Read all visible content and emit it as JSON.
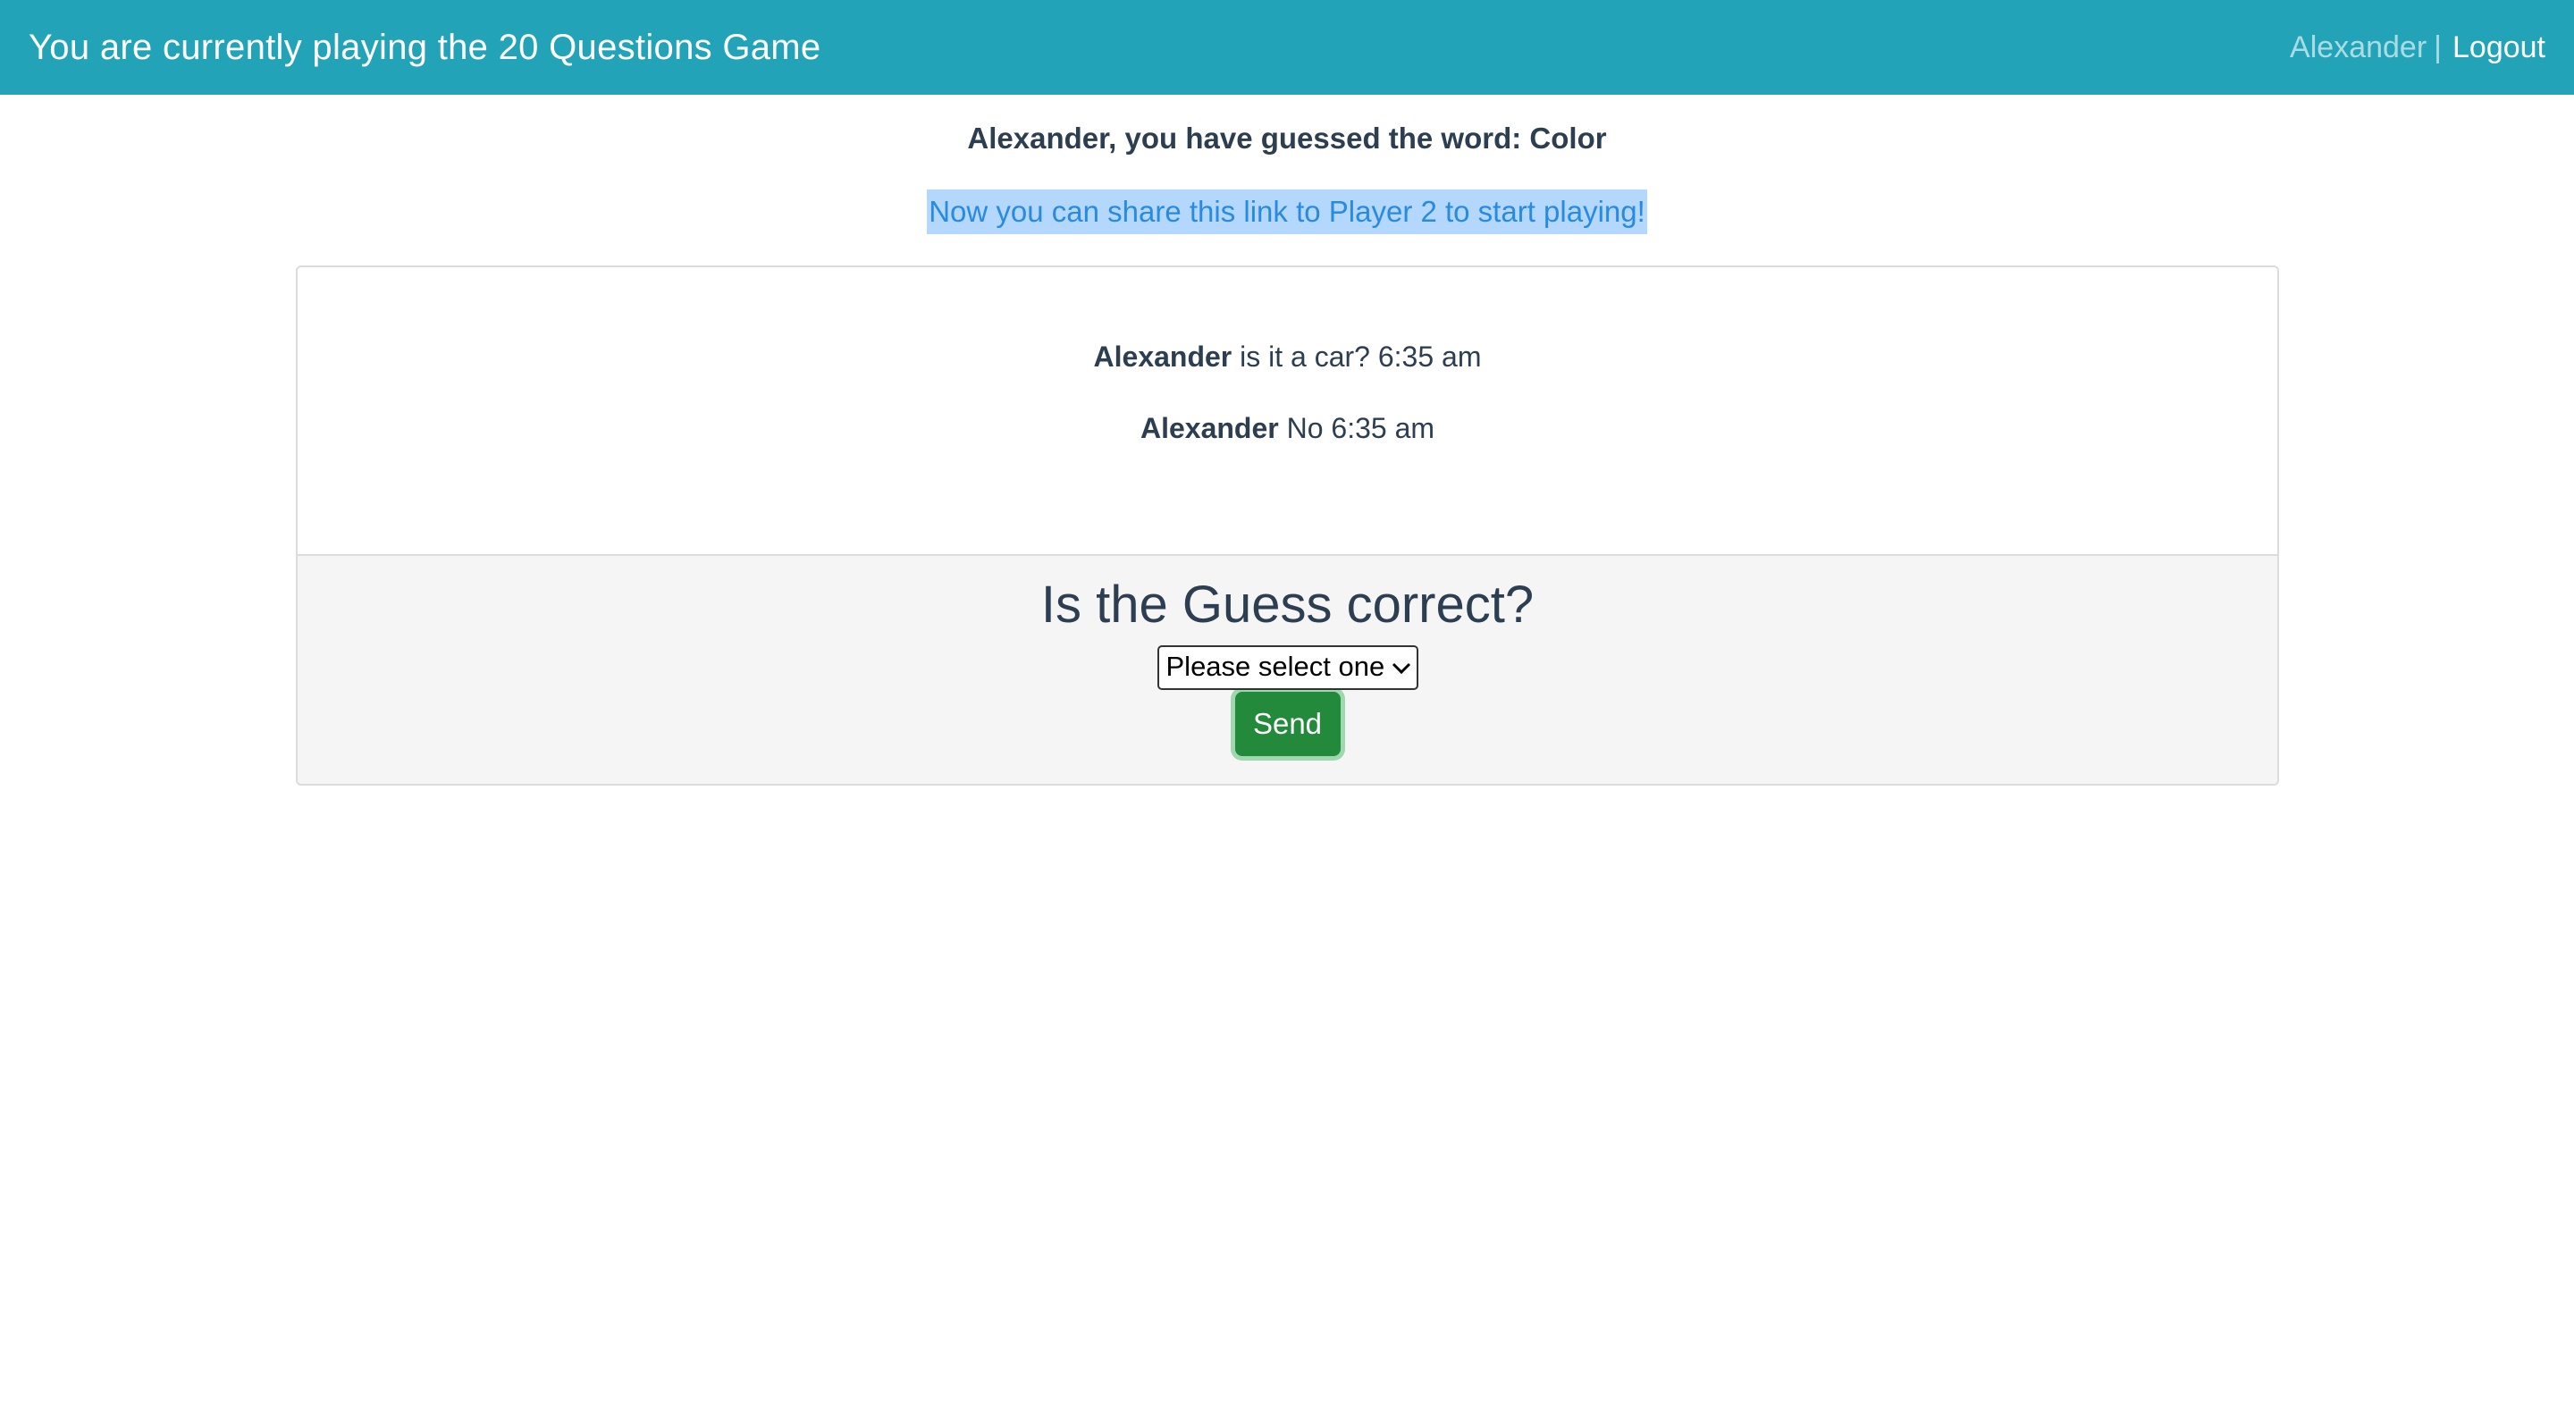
{
  "navbar": {
    "title": "You are currently playing the 20 Questions Game",
    "user": "Alexander",
    "separator": "|",
    "logout": "Logout"
  },
  "status": {
    "headline": "Alexander, you have guessed the word: Color",
    "share_link": "Now you can share this link to Player 2 to start playing!"
  },
  "messages": [
    {
      "author": "Alexander",
      "text": "is it a car?",
      "time": "6:35 am"
    },
    {
      "author": "Alexander",
      "text": "No",
      "time": "6:35 am"
    }
  ],
  "guess_form": {
    "question": "Is the Guess correct?",
    "select_value": "Please select one",
    "send_label": "Send"
  },
  "colors": {
    "navbar": "#22a3b8",
    "send_button": "#238a3c",
    "link": "#2a8ae0",
    "link_highlight": "#b3d7fd"
  },
  "icons": {
    "select_arrow": "chevron-down-icon"
  }
}
